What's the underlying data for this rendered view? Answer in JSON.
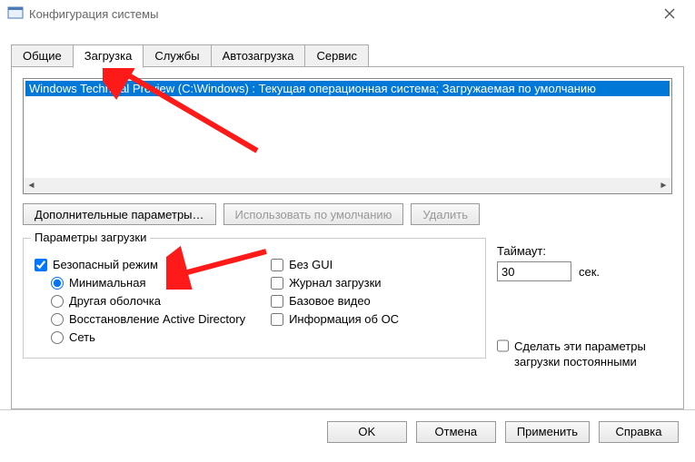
{
  "window": {
    "title": "Конфигурация системы"
  },
  "tabs": {
    "general": "Общие",
    "boot": "Загрузка",
    "services": "Службы",
    "startup": "Автозагрузка",
    "tools": "Сервис"
  },
  "boot_entry": "Windows Technical Preview (C:\\Windows) : Текущая операционная система; Загружаемая по умолчанию",
  "buttons": {
    "advanced": "Дополнительные параметры…",
    "default": "Использовать по умолчанию",
    "delete": "Удалить"
  },
  "group": {
    "legend": "Параметры загрузки"
  },
  "opts": {
    "safe": "Безопасный режим",
    "minimal": "Минимальная",
    "altshell": "Другая оболочка",
    "adrepair": "Восстановление Active Directory",
    "network": "Сеть",
    "nogui": "Без GUI",
    "bootlog": "Журнал загрузки",
    "basevideo": "Базовое видео",
    "osinfo": "Информация  об ОС"
  },
  "timeout": {
    "label": "Таймаут:",
    "value": "30",
    "unit": "сек."
  },
  "persist": {
    "label": "Сделать эти параметры загрузки постоянными"
  },
  "footer": {
    "ok": "OK",
    "cancel": "Отмена",
    "apply": "Применить",
    "help": "Справка"
  }
}
